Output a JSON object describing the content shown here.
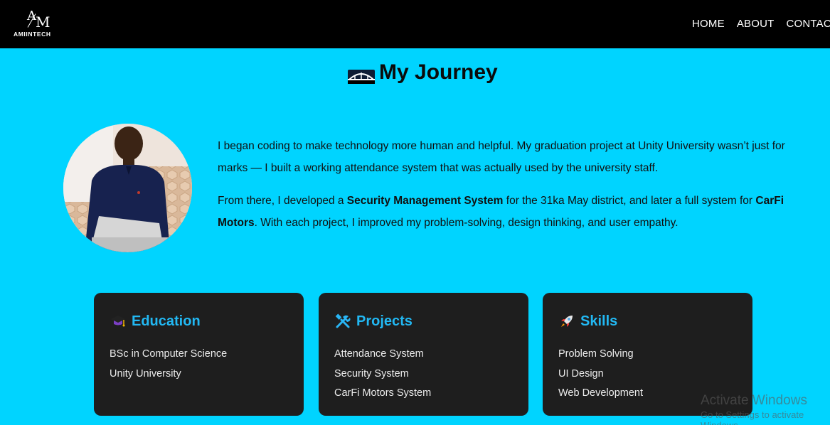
{
  "brand": {
    "logo_text": "AMIINTECH",
    "logo_mark": "AM"
  },
  "nav": {
    "items": [
      "HOME",
      "ABOUT",
      "CONTACT"
    ]
  },
  "page": {
    "title": "My Journey"
  },
  "bio": {
    "p1": "I began coding to make technology more human and helpful. My graduation project at Unity University wasn’t just for marks — I built a working attendance system that was actually used by the university staff.",
    "p2_a": "From there, I developed a ",
    "p2_b": "Security Management System",
    "p2_c": " for the 31ka May district, and later a full system for ",
    "p2_d": "CarFi Motors",
    "p2_e": ". With each project, I improved my problem-solving, design thinking, and user empathy."
  },
  "cards": [
    {
      "title": "Education",
      "icon": "graduation-cap-icon",
      "items": [
        "BSc in Computer Science",
        "Unity University"
      ]
    },
    {
      "title": "Projects",
      "icon": "tools-icon",
      "items": [
        "Attendance System",
        "Security System",
        "CarFi Motors System"
      ]
    },
    {
      "title": "Skills",
      "icon": "rocket-icon",
      "items": [
        "Problem Solving",
        "UI Design",
        "Web Development"
      ]
    }
  ],
  "watermark": {
    "title": "Activate Windows",
    "subtitle": "Go to Settings to activate Windows."
  },
  "colors": {
    "background": "#00d4ff",
    "header": "#000000",
    "card": "#1e1e1e",
    "accent": "#22b8f3"
  }
}
